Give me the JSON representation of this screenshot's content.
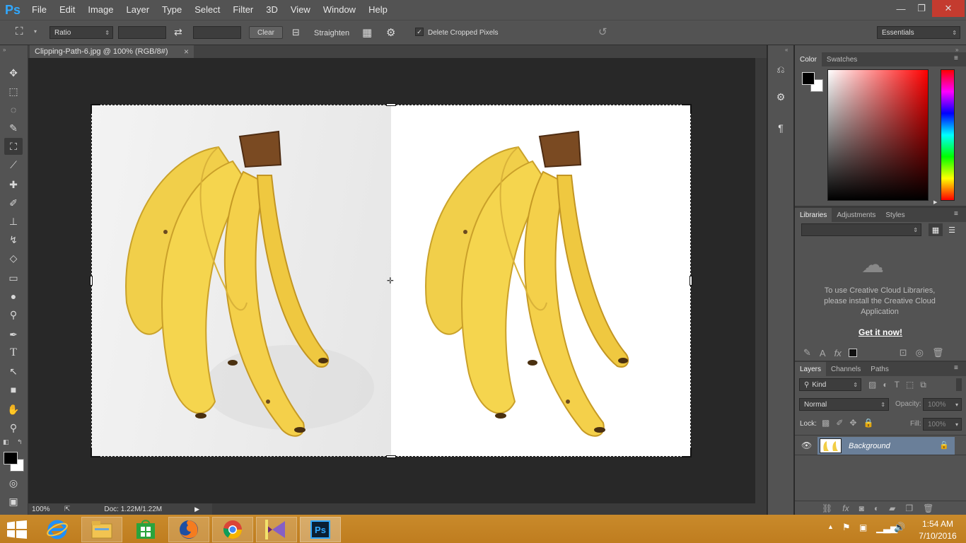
{
  "app": {
    "logo": "Ps",
    "menus": [
      "File",
      "Edit",
      "Image",
      "Layer",
      "Type",
      "Select",
      "Filter",
      "3D",
      "View",
      "Window",
      "Help"
    ]
  },
  "window_controls": {
    "minimize": "—",
    "restore": "❐",
    "close": "✕"
  },
  "options_bar": {
    "ratio_select": "Ratio",
    "clear_label": "Clear",
    "straighten_label": "Straighten",
    "delete_cropped_label": "Delete Cropped Pixels",
    "delete_cropped_checked": true,
    "workspace_select": "Essentials"
  },
  "document": {
    "tab_title": "Clipping-Path-6.jpg @ 100% (RGB/8#)",
    "close_glyph": "×"
  },
  "status": {
    "zoom": "100%",
    "doc_info": "Doc: 1.22M/1.22M"
  },
  "color_panel": {
    "tabs": [
      "Color",
      "Swatches"
    ],
    "foreground": "#000000",
    "background": "#ffffff",
    "hue": "#ff0000"
  },
  "libraries_panel": {
    "tabs": [
      "Libraries",
      "Adjustments",
      "Styles"
    ],
    "message": "To use Creative Cloud Libraries, please install the Creative Cloud Application",
    "link": "Get it now!"
  },
  "layers_panel": {
    "tabs": [
      "Layers",
      "Channels",
      "Paths"
    ],
    "filter_kind": "Kind",
    "blend_mode": "Normal",
    "opacity_label": "Opacity:",
    "opacity_value": "100%",
    "lock_label": "Lock:",
    "fill_label": "Fill:",
    "fill_value": "100%",
    "layers": [
      {
        "name": "Background",
        "visible": true,
        "locked": true
      }
    ]
  },
  "taskbar": {
    "time": "1:54 AM",
    "date": "7/10/2016",
    "colors": {
      "bar": "#c4821f"
    }
  }
}
